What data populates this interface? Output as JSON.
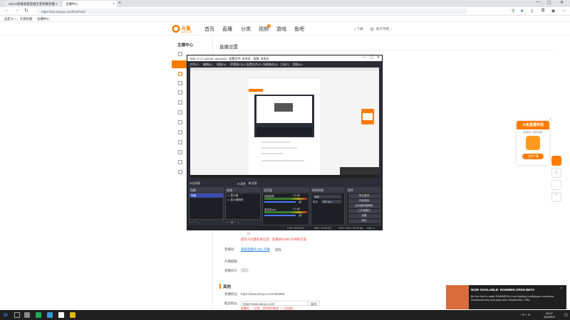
{
  "browser": {
    "tabs": [
      {
        "label": "ok123英雄联盟直播王者荣耀直播..."
      },
      {
        "label": "主播中心"
      }
    ],
    "new_tab": "+",
    "url": "https://mp.douyu.com/live/main",
    "bookmarks": [
      "自定义一，在新标题",
      "主播中心"
    ],
    "window_controls": [
      "—",
      "▢",
      "✕"
    ]
  },
  "site": {
    "logo_text": "斗鱼",
    "logo_sub": "DOUYU.COM",
    "nav": [
      "首页",
      "直播",
      "分类",
      "视频",
      "游戏",
      "鱼吧"
    ],
    "nav_badge": "3",
    "header_right": {
      "download": "下载",
      "user": "鹿子鸡啄"
    }
  },
  "sidebar": {
    "title": "主播中心",
    "active": "直播"
  },
  "main": {
    "page_title": "直播设置",
    "section_other": "其他",
    "form": {
      "hint_red": "提示人比我有关信息，直播间/ID/90 分钟的方案",
      "room_label": "直播间:",
      "room_link": "超级直播间 (ID) 开播",
      "room_btn": "修改",
      "notice_label": "开播提醒:",
      "live_label": "直播间号:",
      "url_label": "直播地址:",
      "url_value": "https://www.douyu.com/395999",
      "code_label": "推流地址:",
      "code_value": "https://www.douyu.com/",
      "code_btn": "复制",
      "code_hint": "直播码：一次性，仅供单次使用（一天有效）"
    }
  },
  "obs": {
    "title": "OBS 27.2.4 (64-bit, windows) - 配置文件: 未命名 - 场景: 未命名",
    "menu": [
      "文件(F)",
      "编辑(E)",
      "视图(V)",
      "停靠窗口(D)",
      "配置文件(P)",
      "场景集合(S)",
      "工具(T)",
      "帮助(H)"
    ],
    "dock_headers": [
      "场景",
      "来源",
      "混音器",
      "转场特效",
      "控件"
    ],
    "filters_label": "未选择源",
    "props_btn": "属性",
    "filter_btn": "滤镜",
    "scenes": [
      "场景"
    ],
    "sources": [
      "显示器",
      "显示器捕获"
    ],
    "mixer": [
      {
        "name": "桌面音频",
        "db": "0.0 dB"
      },
      {
        "name": "麦克风/Aux",
        "db": "0.0 dB"
      }
    ],
    "transition": {
      "type": "渐变",
      "duration_label": "时长",
      "duration": "300 ms"
    },
    "controls": [
      "停止推流",
      "开始录制",
      "启动虚拟摄像机",
      "工作室模式",
      "设置",
      "退出"
    ],
    "status": {
      "live": "LIVE: 00:00:00",
      "rec": "REC: 00:00:00",
      "cpu": "CPU: 0.4%, 30.00 fps",
      "kbps": "kb/s: 0"
    }
  },
  "promo": {
    "title": "斗鱼直播伴侣",
    "subtitle": "新版本 全新来袭",
    "button": "立即下载"
  },
  "notification": {
    "title": "NOW AVAILABLE: RAWMEN OPEN BETA",
    "body": "Be the first to taste RAWMEN's food-fighting multiplayer madness. Download now and play from September 2-5th."
  },
  "taskbar": {
    "time": "19:47",
    "date": "2022/9/3"
  },
  "colors": {
    "accent": "#ff7b00",
    "obs_bg": "#2b2e38",
    "link": "#2b7de9",
    "red": "#e53935"
  }
}
